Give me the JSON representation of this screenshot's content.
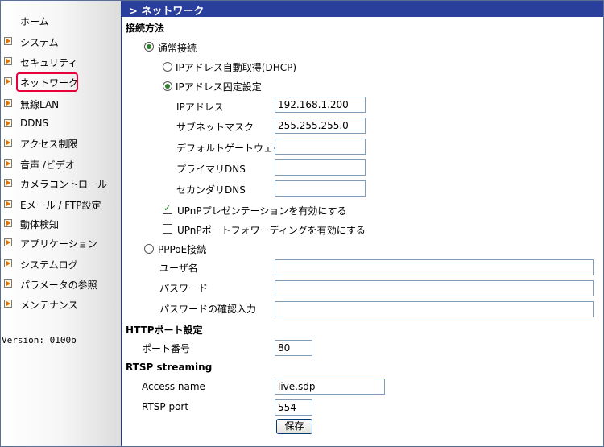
{
  "sidebar": {
    "home": "ホーム",
    "items": [
      {
        "label": "システム"
      },
      {
        "label": "セキュリティ"
      },
      {
        "label": "ネットワーク",
        "selected": true
      },
      {
        "label": "無線LAN"
      },
      {
        "label": "DDNS"
      },
      {
        "label": "アクセス制限"
      },
      {
        "label": "音声 /ビデオ"
      },
      {
        "label": "カメラコントロール"
      },
      {
        "label": "Eメール / FTP設定"
      },
      {
        "label": "動体検知"
      },
      {
        "label": "アプリケーション"
      },
      {
        "label": "システムログ"
      },
      {
        "label": "パラメータの参照"
      },
      {
        "label": "メンテナンス"
      }
    ],
    "version": "Version: 0100b"
  },
  "header": {
    "title": "> ネットワーク"
  },
  "connection": {
    "section_title": "接続方法",
    "normal_label": "通常接続",
    "normal_selected": true,
    "dhcp_label": "IPアドレス自動取得(DHCP)",
    "dhcp_selected": false,
    "static_label": "IPアドレス固定設定",
    "static_selected": true,
    "ip_label": "IPアドレス",
    "ip_value": "192.168.1.200",
    "mask_label": "サブネットマスク",
    "mask_value": "255.255.255.0",
    "gateway_label": "デフォルトゲートウェイ",
    "gateway_value": "",
    "dns1_label": "プライマリDNS",
    "dns1_value": "",
    "dns2_label": "セカンダリDNS",
    "dns2_value": "",
    "upnp_present_label": "UPnPプレゼンテーションを有効にする",
    "upnp_present_checked": true,
    "upnp_forward_label": "UPnPポートフォワーディングを有効にする",
    "upnp_forward_checked": false,
    "pppoe_label": "PPPoE接続",
    "pppoe_selected": false,
    "user_label": "ユーザ名",
    "user_value": "",
    "password_label": "パスワード",
    "password_value": "",
    "password_confirm_label": "パスワードの確認入力",
    "password_confirm_value": ""
  },
  "http": {
    "section_title": "HTTPポート設定",
    "port_label": "ポート番号",
    "port_value": "80"
  },
  "rtsp": {
    "section_title": "RTSP streaming",
    "access_name_label": "Access name",
    "access_name_value": "live.sdp",
    "port_label": "RTSP port",
    "port_value": "554"
  },
  "save_label": "保存"
}
